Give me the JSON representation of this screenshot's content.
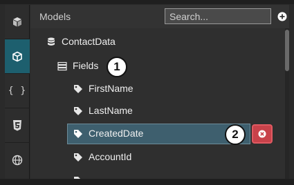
{
  "header": {
    "title": "Models",
    "search_placeholder": "Search...",
    "add_icon": "plus-circle-icon"
  },
  "sidebar": {
    "items": [
      {
        "icon": "cubes-icon",
        "active": false
      },
      {
        "icon": "cube-icon",
        "active": true
      },
      {
        "icon": "braces-icon",
        "label": "{ }",
        "active": false
      },
      {
        "icon": "css3-icon",
        "active": false
      },
      {
        "icon": "globe-icon",
        "active": false
      }
    ]
  },
  "tree": {
    "root": {
      "label": "ContactData",
      "icon": "database-icon"
    },
    "group": {
      "label": "Fields",
      "icon": "list-icon"
    },
    "fields": [
      {
        "label": "FirstName",
        "icon": "tag-icon"
      },
      {
        "label": "LastName",
        "icon": "tag-icon"
      },
      {
        "label": "CreatedDate",
        "icon": "tag-icon",
        "selected": true
      },
      {
        "label": "AccountId",
        "icon": "tag-icon"
      }
    ]
  },
  "callouts": [
    "1",
    "2"
  ],
  "delete_icon": "remove-circle-icon",
  "colors": {
    "accent": "#1d5f6e",
    "selection": "#3e5f6e",
    "delete": "#c8424a"
  }
}
